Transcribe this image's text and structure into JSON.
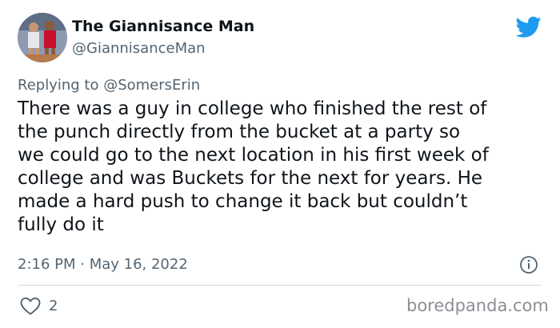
{
  "author": {
    "display_name": "The Giannisance Man",
    "handle": "@GiannisanceMan",
    "avatar_icon": "profile-photo-basketball-players"
  },
  "reply": {
    "text": "Replying to @SomersErin"
  },
  "body_lines": [
    "There was a guy in college who finished the rest of",
    "the punch directly from the bucket at a party so",
    "we could go to the next location in his first week of",
    "college and was Buckets for the next for years. He",
    "made a hard push to change it back but couldn’t",
    "fully do it"
  ],
  "meta": {
    "timestamp": "2:16 PM · May 16, 2022"
  },
  "actions": {
    "like_count": "2"
  },
  "watermark": "boredpanda.com",
  "colors": {
    "twitter_blue": "#1d9bf0",
    "text_primary": "#0f1419",
    "text_secondary": "#536471",
    "divider": "#cfd9de"
  }
}
